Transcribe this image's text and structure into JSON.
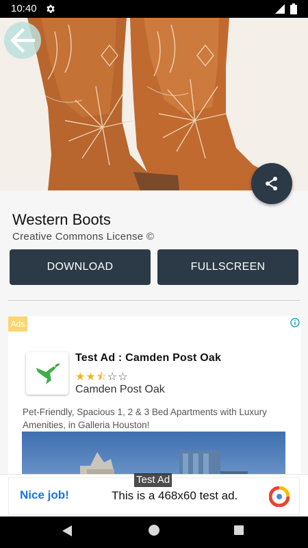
{
  "status_bar": {
    "time": "10:40",
    "icons": [
      "gear-icon",
      "signal-icon",
      "battery-icon"
    ]
  },
  "hero": {
    "image": "western-boots-photo",
    "back_icon": "arrow-left-icon",
    "share_icon": "share-icon"
  },
  "item": {
    "title": "Western Boots",
    "license": "Creative Commons License ©"
  },
  "buttons": {
    "download": "DOWNLOAD",
    "fullscreen": "FULLSCREEN"
  },
  "ad": {
    "badge": "Ads",
    "headline": "Test Ad : Camden Post Oak",
    "rating": 2.5,
    "rating_max": 5,
    "advertiser": "Camden Post Oak",
    "body": "Pet-Friendly, Spacious 1, 2 & 3 Bed Apartments with Luxury Amenities, in Galleria Houston!",
    "logo_icon": "hummingbird-logo-icon",
    "info_icon": "info-icon"
  },
  "banner": {
    "label": "Test Ad",
    "cta": "Nice job!",
    "text": "This is a 468x60 test ad."
  },
  "colors": {
    "primary_dark": "#2c3a47",
    "ads_badge": "#f8d773",
    "banner_cta": "#1a73e8",
    "star": "#f0b429"
  }
}
